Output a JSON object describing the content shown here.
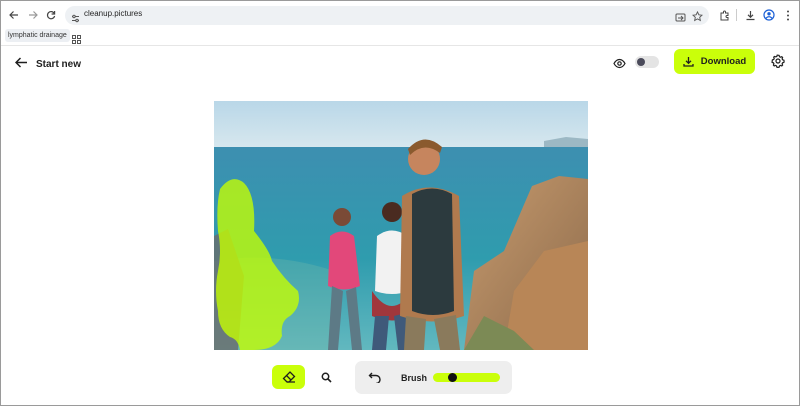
{
  "browser": {
    "url": "cleanup.pictures",
    "bookmark_label": "lymphatic drainage"
  },
  "header": {
    "back_label": "Start new",
    "download_label": "Download",
    "compare_toggle_on": false
  },
  "toolbar": {
    "brush_label": "Brush",
    "brush_size": 0.25
  },
  "colors": {
    "accent": "#caff0a",
    "mask": "#c7ff00"
  },
  "icons": [
    "back-arrow-icon",
    "forward-arrow-icon",
    "reload-icon",
    "site-settings-icon",
    "cast-icon",
    "star-icon",
    "extensions-icon",
    "download-icon",
    "profile-icon",
    "more-icon",
    "apps-icon",
    "arrow-left-icon",
    "eye-icon",
    "gear-icon",
    "eraser-icon",
    "magnifier-icon",
    "undo-icon"
  ]
}
